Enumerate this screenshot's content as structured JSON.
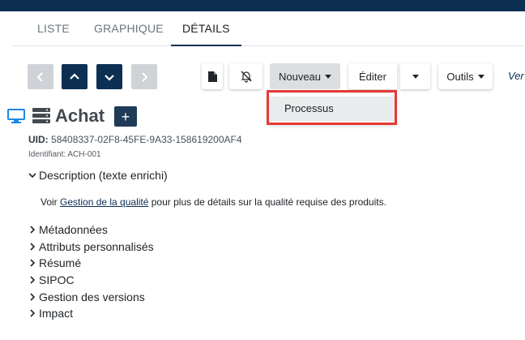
{
  "tabs": [
    {
      "label": "LISTE",
      "active": false
    },
    {
      "label": "GRAPHIQUE",
      "active": false
    },
    {
      "label": "DÉTAILS",
      "active": true
    }
  ],
  "toolbar": {
    "nouveau_label": "Nouveau",
    "editer_label": "Éditer",
    "outils_label": "Outils",
    "version_label": "Ver"
  },
  "dropdown": {
    "items": [
      "Processus"
    ],
    "highlight_color": "#e53935"
  },
  "record": {
    "title": "Achat",
    "plus_label": "+",
    "uid_label": "UID:",
    "uid_value": "58408337-02F8-45FE-9A33-158619200AF4",
    "identifiant_label": "Identifiant:",
    "identifiant_value": "ACH-001"
  },
  "description": {
    "header": "Description (texte enrichi)",
    "text_before": "Voir ",
    "link_text": "Gestion de la qualité",
    "text_after": " pour plus de détails sur la qualité requise des produits."
  },
  "sections": [
    "Métadonnées",
    "Attributs personnalisés",
    "Résumé",
    "SIPOC",
    "Gestion des versions",
    "Impact"
  ],
  "colors": {
    "brand": "#0c2f52",
    "accent": "#1f3b58",
    "monitor_icon": "#1e88e5"
  },
  "icons": [
    "chevron-left-icon",
    "chevron-up-icon",
    "chevron-down-icon",
    "chevron-right-icon",
    "file-icon",
    "bell-slash-icon",
    "caret-down-icon",
    "monitor-icon",
    "server-icon",
    "plus-icon"
  ]
}
